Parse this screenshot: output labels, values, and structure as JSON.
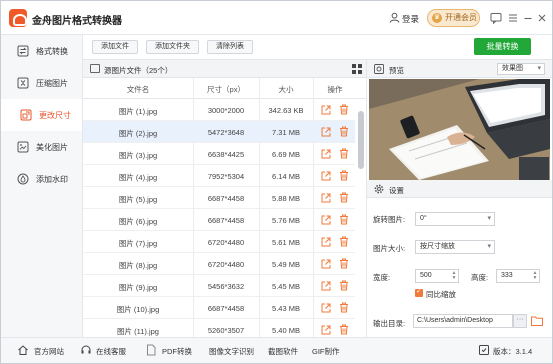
{
  "app": {
    "title": "金舟图片格式转换器",
    "login": "登录",
    "vip_button": "开通会员",
    "vip_icon": "crown-icon"
  },
  "sidebar": {
    "items": [
      {
        "label": "格式转换",
        "icon": "convert-icon",
        "active": false
      },
      {
        "label": "压缩图片",
        "icon": "compress-icon",
        "active": false
      },
      {
        "label": "更改尺寸",
        "icon": "resize-icon",
        "active": true
      },
      {
        "label": "美化图片",
        "icon": "beautify-icon",
        "active": false
      },
      {
        "label": "添加水印",
        "icon": "watermark-icon",
        "active": false
      }
    ]
  },
  "toolbar": {
    "add_file": "添加文件",
    "add_folder": "添加文件夹",
    "clear_list": "清除列表",
    "batch_convert": "批量转换"
  },
  "file_panel": {
    "title": "源图片文件（25个）",
    "columns": [
      "文件名",
      "尺寸（px）",
      "大小",
      "操作"
    ],
    "rows": [
      {
        "name": "图片 (1).jpg",
        "size_px": "3000*2000",
        "size": "342.63 KB",
        "selected": false
      },
      {
        "name": "图片 (2).jpg",
        "size_px": "5472*3648",
        "size": "7.31 MB",
        "selected": true
      },
      {
        "name": "图片 (3).jpg",
        "size_px": "6638*4425",
        "size": "6.69 MB",
        "selected": false
      },
      {
        "name": "图片 (4).jpg",
        "size_px": "7952*5304",
        "size": "6.14 MB",
        "selected": false
      },
      {
        "name": "图片 (5).jpg",
        "size_px": "6687*4458",
        "size": "5.88 MB",
        "selected": false
      },
      {
        "name": "图片 (6).jpg",
        "size_px": "6687*4458",
        "size": "5.76 MB",
        "selected": false
      },
      {
        "name": "图片 (7).jpg",
        "size_px": "6720*4480",
        "size": "5.61 MB",
        "selected": false
      },
      {
        "name": "图片 (8).jpg",
        "size_px": "6720*4480",
        "size": "5.49 MB",
        "selected": false
      },
      {
        "name": "图片 (9).jpg",
        "size_px": "5456*3632",
        "size": "5.45 MB",
        "selected": false
      },
      {
        "name": "图片 (10).jpg",
        "size_px": "6687*4458",
        "size": "5.43 MB",
        "selected": false
      },
      {
        "name": "图片 (11).jpg",
        "size_px": "5260*3507",
        "size": "5.40 MB",
        "selected": false
      }
    ]
  },
  "preview": {
    "title": "预览",
    "mode": "效果图"
  },
  "settings": {
    "title": "设置",
    "rotate_label": "旋转图片:",
    "rotate_value": "0°",
    "resize_label": "图片大小:",
    "resize_value": "按尺寸缩放",
    "width_label": "宽度:",
    "width_value": "500",
    "height_label": "高度:",
    "height_value": "333",
    "keep_ratio_label": "同比缩放",
    "keep_ratio_checked": true,
    "output_label": "输出目录:",
    "output_path": "C:\\Users\\admin\\Desktop"
  },
  "bottom_bar": {
    "items": [
      {
        "label": "官方网站",
        "icon": "home-icon"
      },
      {
        "label": "在线客服",
        "icon": "headset-icon"
      },
      {
        "label": "PDF转换",
        "icon": ""
      },
      {
        "label": "图像文字识别",
        "icon": ""
      },
      {
        "label": "截图软件",
        "icon": ""
      },
      {
        "label": "GIF制作",
        "icon": ""
      }
    ],
    "version": "版本：3.1.4"
  },
  "colors": {
    "accent": "#e8542b",
    "batch_green": "#22a838",
    "selected_row": "#e8f1fc",
    "vip_bg": "#fbe9cf"
  }
}
